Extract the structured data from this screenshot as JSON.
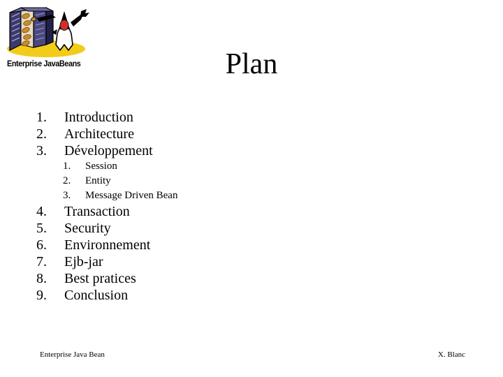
{
  "logo": {
    "alt_name": "enterprise-javabeans-logo",
    "caption": "Enterprise JavaBeans",
    "colors": {
      "server": "#3b3a6e",
      "server_light": "#8a89b8",
      "server_dark": "#22214a",
      "ground": "#f2cb1b",
      "bean": "#c98a2e",
      "duke_body": "#ffffff",
      "duke_outline": "#000000",
      "duke_nose": "#d1302a",
      "text": "#000000"
    }
  },
  "title": "Plan",
  "outline": [
    {
      "num": "1.",
      "label": "Introduction",
      "children": []
    },
    {
      "num": "2.",
      "label": "Architecture",
      "children": []
    },
    {
      "num": "3.",
      "label": "Développement",
      "children": [
        {
          "num": "1.",
          "label": "Session"
        },
        {
          "num": "2.",
          "label": "Entity"
        },
        {
          "num": "3.",
          "label": "Message Driven Bean"
        }
      ]
    },
    {
      "num": "4.",
      "label": "Transaction",
      "children": []
    },
    {
      "num": "5.",
      "label": "Security",
      "children": []
    },
    {
      "num": "6.",
      "label": "Environnement",
      "children": []
    },
    {
      "num": "7.",
      "label": "Ejb-jar",
      "children": []
    },
    {
      "num": "8.",
      "label": "Best pratices",
      "children": []
    },
    {
      "num": "9.",
      "label": "Conclusion",
      "children": []
    }
  ],
  "footer": {
    "left": "Enterprise Java Bean",
    "right": "X. Blanc"
  }
}
